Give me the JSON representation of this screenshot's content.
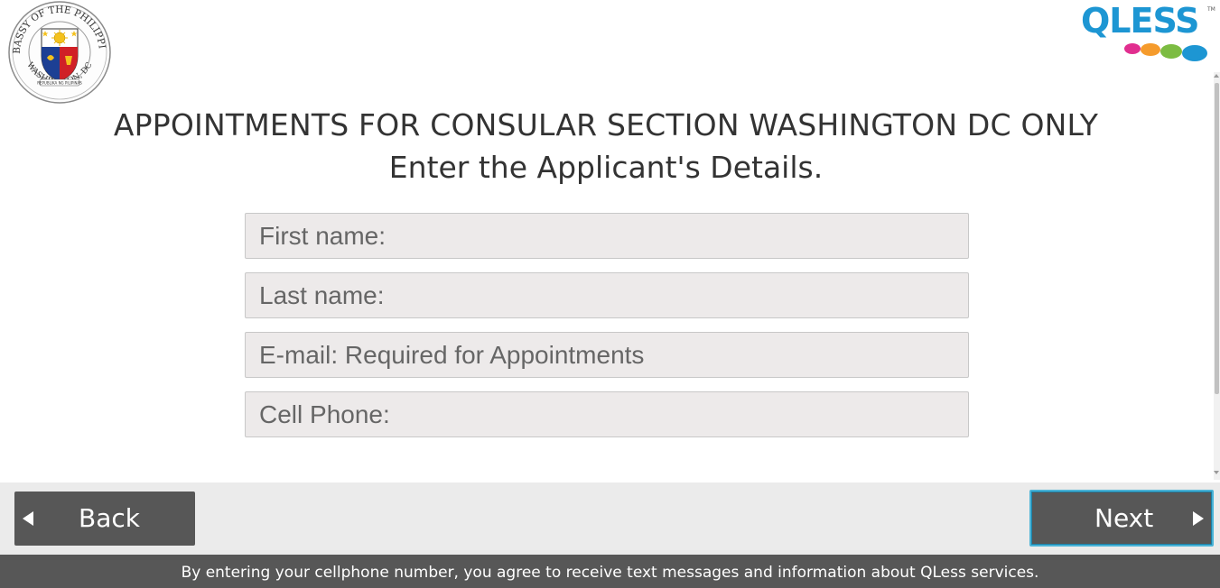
{
  "seal": {
    "top_text": "EMBASSY OF THE PHILIPPINES",
    "bottom_text": "WASHINGTON, DC",
    "ribbon_text": "REPUBLIKA NG PILIPINAS"
  },
  "brand": {
    "logo_text": "QLESS",
    "trademark": "TM",
    "accent": "#1d96d3",
    "dot_colors": [
      "#e12e8f",
      "#f59b2c",
      "#7cbc42",
      "#1d96d3"
    ]
  },
  "heading": {
    "line1": "APPOINTMENTS FOR CONSULAR SECTION WASHINGTON DC ONLY",
    "line2": "Enter the Applicant's Details."
  },
  "form": {
    "first_name_placeholder": "First name:",
    "last_name_placeholder": "Last name:",
    "email_placeholder": "E-mail: Required for Appointments",
    "phone_placeholder": "Cell Phone:"
  },
  "nav": {
    "back_label": "Back",
    "next_label": "Next"
  },
  "footer": {
    "text": "By entering your cellphone number, you agree to receive text messages and information about QLess services."
  }
}
